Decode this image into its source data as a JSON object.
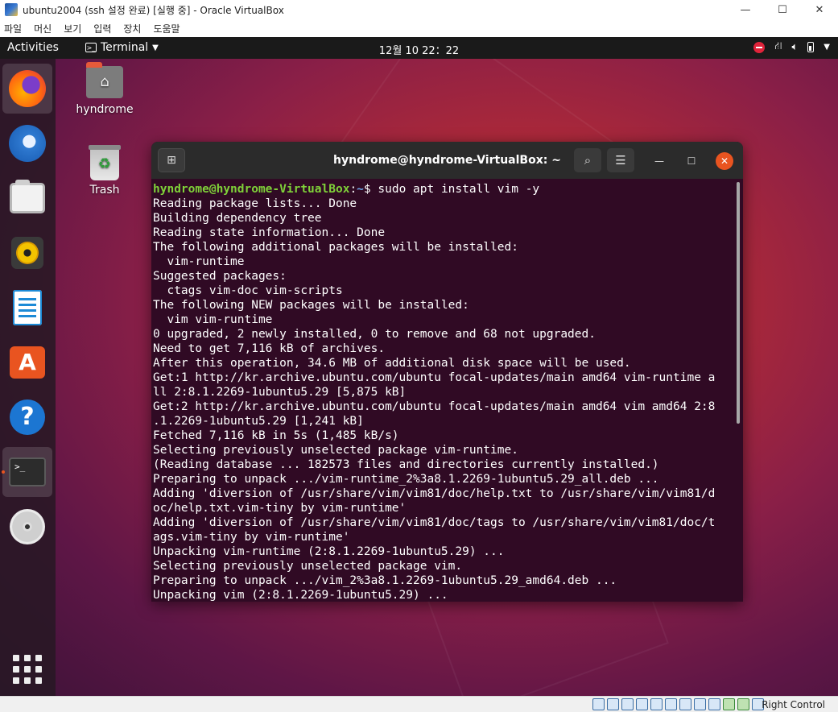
{
  "host": {
    "title": "ubuntu2004 (ssh 설정 완료) [실행 중] - Oracle VirtualBox",
    "window_controls": {
      "minimize": "—",
      "maximize": "☐",
      "close": "✕"
    },
    "menu": [
      "파일",
      "머신",
      "보기",
      "입력",
      "장치",
      "도움말"
    ],
    "status": {
      "host_key": "Right Control"
    }
  },
  "topbar": {
    "activities": "Activities",
    "app_menu": "Terminal",
    "clock": "12월 10  22：22"
  },
  "desktop": {
    "icons": [
      {
        "label": "hyndrome"
      },
      {
        "label": "Trash"
      }
    ]
  },
  "dock": {
    "apps": [
      "firefox-icon",
      "thunderbird-icon",
      "files-icon",
      "rhythmbox-icon",
      "writer-icon",
      "software-icon",
      "help-icon",
      "terminal-icon",
      "dvd-icon"
    ]
  },
  "terminal": {
    "title": "hyndrome@hyndrome-VirtualBox: ~",
    "prompt_user": "hyndrome@hyndrome-VirtualBox",
    "prompt_sep": ":",
    "prompt_path": "~",
    "prompt_end": "$ ",
    "command": "sudo apt install vim -y",
    "output": [
      "Reading package lists... Done",
      "Building dependency tree",
      "Reading state information... Done",
      "The following additional packages will be installed:",
      "  vim-runtime",
      "Suggested packages:",
      "  ctags vim-doc vim-scripts",
      "The following NEW packages will be installed:",
      "  vim vim-runtime",
      "0 upgraded, 2 newly installed, 0 to remove and 68 not upgraded.",
      "Need to get 7,116 kB of archives.",
      "After this operation, 34.6 MB of additional disk space will be used.",
      "Get:1 http://kr.archive.ubuntu.com/ubuntu focal-updates/main amd64 vim-runtime a",
      "ll 2:8.1.2269-1ubuntu5.29 [5,875 kB]",
      "Get:2 http://kr.archive.ubuntu.com/ubuntu focal-updates/main amd64 vim amd64 2:8",
      ".1.2269-1ubuntu5.29 [1,241 kB]",
      "Fetched 7,116 kB in 5s (1,485 kB/s)",
      "Selecting previously unselected package vim-runtime.",
      "(Reading database ... 182573 files and directories currently installed.)",
      "Preparing to unpack .../vim-runtime_2%3a8.1.2269-1ubuntu5.29_all.deb ...",
      "Adding 'diversion of /usr/share/vim/vim81/doc/help.txt to /usr/share/vim/vim81/d",
      "oc/help.txt.vim-tiny by vim-runtime'",
      "Adding 'diversion of /usr/share/vim/vim81/doc/tags to /usr/share/vim/vim81/doc/t",
      "ags.vim-tiny by vim-runtime'",
      "Unpacking vim-runtime (2:8.1.2269-1ubuntu5.29) ...",
      "Selecting previously unselected package vim.",
      "Preparing to unpack .../vim_2%3a8.1.2269-1ubuntu5.29_amd64.deb ...",
      "Unpacking vim (2:8.1.2269-1ubuntu5.29) ..."
    ]
  },
  "colors": {
    "terminal_bg": "#300a24",
    "prompt_user": "#7fd139",
    "prompt_path": "#6ea6e8",
    "accent": "#e95420"
  }
}
